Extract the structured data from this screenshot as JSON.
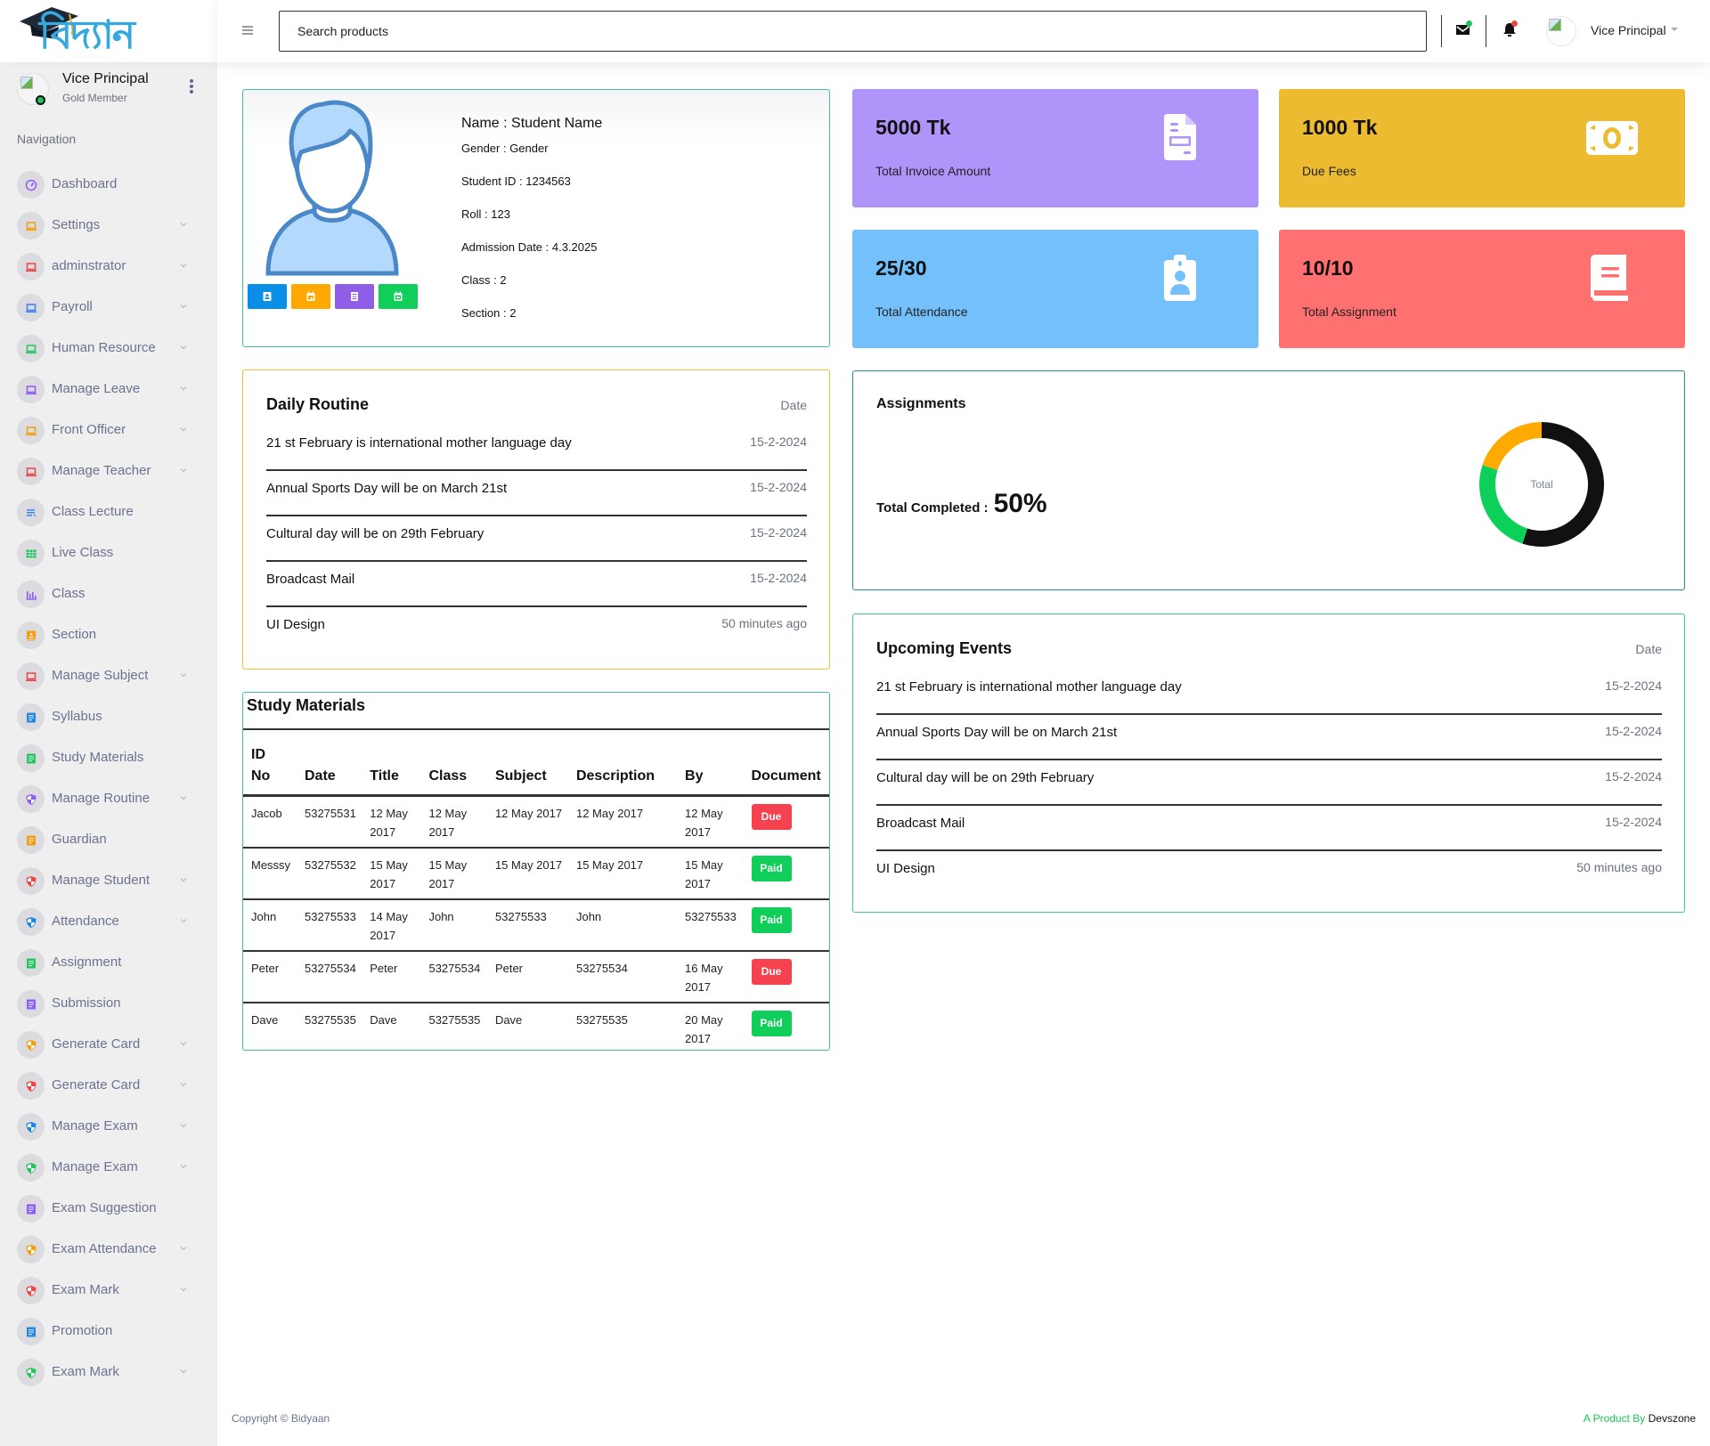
{
  "brand": {
    "logo_text": "বিদ্যান"
  },
  "sidebar": {
    "user": {
      "name": "Vice Principal",
      "role": "Gold Member"
    },
    "nav_title": "Navigation",
    "items": [
      {
        "label": "Dashboard",
        "icon": "speedometer-icon",
        "color": "#8b5cf6",
        "chevron": false
      },
      {
        "label": "Settings",
        "icon": "laptop-icon",
        "color": "#f59e0b",
        "chevron": true
      },
      {
        "label": "adminstrator",
        "icon": "laptop-icon",
        "color": "#ef4444",
        "chevron": true
      },
      {
        "label": "Payroll",
        "icon": "laptop-icon",
        "color": "#3b82f6",
        "chevron": true
      },
      {
        "label": "Human Resource",
        "icon": "laptop-icon",
        "color": "#22c55e",
        "chevron": true
      },
      {
        "label": "Manage Leave",
        "icon": "laptop-icon",
        "color": "#8b5cf6",
        "chevron": true
      },
      {
        "label": "Front Officer",
        "icon": "laptop-icon",
        "color": "#f59e0b",
        "chevron": true
      },
      {
        "label": "Manage Teacher",
        "icon": "laptop-icon",
        "color": "#ef4444",
        "chevron": true
      },
      {
        "label": "Class Lecture",
        "icon": "list-icon",
        "color": "#3b82f6",
        "chevron": false
      },
      {
        "label": "Live Class",
        "icon": "grid-icon",
        "color": "#22c55e",
        "chevron": false
      },
      {
        "label": "Class",
        "icon": "bar-chart-icon",
        "color": "#8b5cf6",
        "chevron": false
      },
      {
        "label": "Section",
        "icon": "contact-card-icon",
        "color": "#f59e0b",
        "chevron": false
      },
      {
        "label": "Manage Subject",
        "icon": "laptop-icon",
        "color": "#ef4444",
        "chevron": true
      },
      {
        "label": "Syllabus",
        "icon": "document-icon",
        "color": "#1e88e5",
        "chevron": false
      },
      {
        "label": "Study Materials",
        "icon": "document-icon",
        "color": "#22c55e",
        "chevron": false
      },
      {
        "label": "Manage Routine",
        "icon": "shield-icon",
        "color": "#8b5cf6",
        "chevron": true
      },
      {
        "label": "Guardian",
        "icon": "document-icon",
        "color": "#f59e0b",
        "chevron": false
      },
      {
        "label": "Manage Student",
        "icon": "shield-icon",
        "color": "#ef4444",
        "chevron": true
      },
      {
        "label": "Attendance",
        "icon": "shield-icon",
        "color": "#1e88e5",
        "chevron": true
      },
      {
        "label": "Assignment",
        "icon": "document-icon",
        "color": "#22c55e",
        "chevron": false
      },
      {
        "label": "Submission",
        "icon": "document-icon",
        "color": "#8b5cf6",
        "chevron": false
      },
      {
        "label": "Generate Card",
        "icon": "shield-icon",
        "color": "#f59e0b",
        "chevron": true
      },
      {
        "label": "Generate Card",
        "icon": "shield-icon",
        "color": "#ef4444",
        "chevron": true
      },
      {
        "label": "Manage Exam",
        "icon": "shield-icon",
        "color": "#1e88e5",
        "chevron": true
      },
      {
        "label": "Manage Exam",
        "icon": "shield-icon",
        "color": "#22c55e",
        "chevron": true
      },
      {
        "label": "Exam Suggestion",
        "icon": "document-icon",
        "color": "#8b5cf6",
        "chevron": false
      },
      {
        "label": "Exam Attendance",
        "icon": "shield-icon",
        "color": "#f59e0b",
        "chevron": true
      },
      {
        "label": "Exam Mark",
        "icon": "shield-icon",
        "color": "#ef4444",
        "chevron": true
      },
      {
        "label": "Promotion",
        "icon": "document-icon",
        "color": "#1e88e5",
        "chevron": false
      },
      {
        "label": "Exam Mark",
        "icon": "shield-icon",
        "color": "#22c55e",
        "chevron": true
      }
    ]
  },
  "topbar": {
    "search_placeholder": "Search products",
    "user_name": "Vice Principal",
    "mail_badge_color": "#1ec45a",
    "bell_badge_color": "#ef4444"
  },
  "student": {
    "name": "Name : Student Name",
    "gender": "Gender : Gender",
    "student_id": "Student ID : 1234563",
    "roll": "Roll : 123",
    "admission_date": "Admission Date : 4.3.2025",
    "class": "Class : 2",
    "section": "Section : 2",
    "action_buttons": [
      {
        "icon": "id-card-icon",
        "color": "#0a8ee6"
      },
      {
        "icon": "calendar-icon",
        "color": "#ffa800"
      },
      {
        "icon": "notes-icon",
        "color": "#8e5ee6"
      },
      {
        "icon": "calendar-check-icon",
        "color": "#0fcf5a"
      }
    ]
  },
  "stats": [
    {
      "value": "5000 Tk",
      "label": "Total Invoice Amount",
      "color": "#af94f9",
      "icon": "invoice-icon",
      "icon_color": "#af94f9"
    },
    {
      "value": "1000 Tk",
      "label": "Due Fees",
      "color": "#ecbb30",
      "icon": "money-icon",
      "icon_color": "#ecbb30"
    },
    {
      "value": "25/30",
      "label": "Total Attendance",
      "color": "#74c0fa",
      "icon": "id-badge-icon",
      "icon_color": "#74c0fa"
    },
    {
      "value": "10/10",
      "label": "Total Assignment",
      "color": "#ff7070",
      "icon": "book-icon",
      "icon_color": "#ff7070"
    }
  ],
  "daily_routine": {
    "title": "Daily Routine",
    "date_header": "Date",
    "rows": [
      {
        "text": "21 st February is international mother language day",
        "date": "15-2-2024"
      },
      {
        "text": "Annual Sports Day will be on March 21st",
        "date": "15-2-2024"
      },
      {
        "text": "Cultural day will be on 29th February",
        "date": "15-2-2024"
      },
      {
        "text": "Broadcast Mail",
        "date": "15-2-2024"
      },
      {
        "text": "UI Design",
        "date": "50 minutes ago"
      }
    ]
  },
  "study_materials": {
    "title": "Study Materials",
    "columns": [
      "ID No",
      "Date",
      "Title",
      "Class",
      "Subject",
      "Description",
      "By",
      "Document"
    ],
    "rows": [
      {
        "cells": [
          "Jacob",
          "53275531",
          "12 May 2017",
          "12 May 2017",
          "12 May 2017",
          "12 May 2017",
          "12 May 2017"
        ],
        "status": "Due"
      },
      {
        "cells": [
          "Messsy",
          "53275532",
          "15 May 2017",
          "15 May 2017",
          "15 May 2017",
          "15 May 2017",
          "15 May 2017"
        ],
        "status": "Paid"
      },
      {
        "cells": [
          "John",
          "53275533",
          "14 May 2017",
          "John",
          "53275533",
          "John",
          "53275533"
        ],
        "status": "Paid"
      },
      {
        "cells": [
          "Peter",
          "53275534",
          "Peter",
          "53275534",
          "Peter",
          "53275534",
          "16 May 2017"
        ],
        "status": "Due"
      },
      {
        "cells": [
          "Dave",
          "53275535",
          "Dave",
          "53275535",
          "Dave",
          "53275535",
          "20 May 2017"
        ],
        "status": "Paid"
      }
    ],
    "status_colors": {
      "Due": "#f5424e",
      "Paid": "#0fcf5a"
    }
  },
  "assignments": {
    "title": "Assignments",
    "total_label": "Total Completed :",
    "total_value": "50%",
    "center_label": "Total"
  },
  "chart_data": {
    "type": "pie",
    "title": "Assignments",
    "center_label": "Total",
    "series": [
      {
        "name": "segment-1",
        "value": 55,
        "color": "#111111"
      },
      {
        "name": "segment-2",
        "value": 25,
        "color": "#0bd15b"
      },
      {
        "name": "segment-3",
        "value": 20,
        "color": "#ffaa00"
      }
    ],
    "legend": "none"
  },
  "upcoming_events": {
    "title": "Upcoming Events",
    "date_header": "Date",
    "rows": [
      {
        "text": "21 st February is international mother language day",
        "date": "15-2-2024"
      },
      {
        "text": "Annual Sports Day will be on March 21st",
        "date": "15-2-2024"
      },
      {
        "text": "Cultural day will be on 29th February",
        "date": "15-2-2024"
      },
      {
        "text": "Broadcast Mail",
        "date": "15-2-2024"
      },
      {
        "text": "UI Design",
        "date": "50 minutes ago"
      }
    ]
  },
  "footer": {
    "copyright": "Copyright © Bidyaan",
    "product_by": "A Product By",
    "company": "Devszone"
  }
}
